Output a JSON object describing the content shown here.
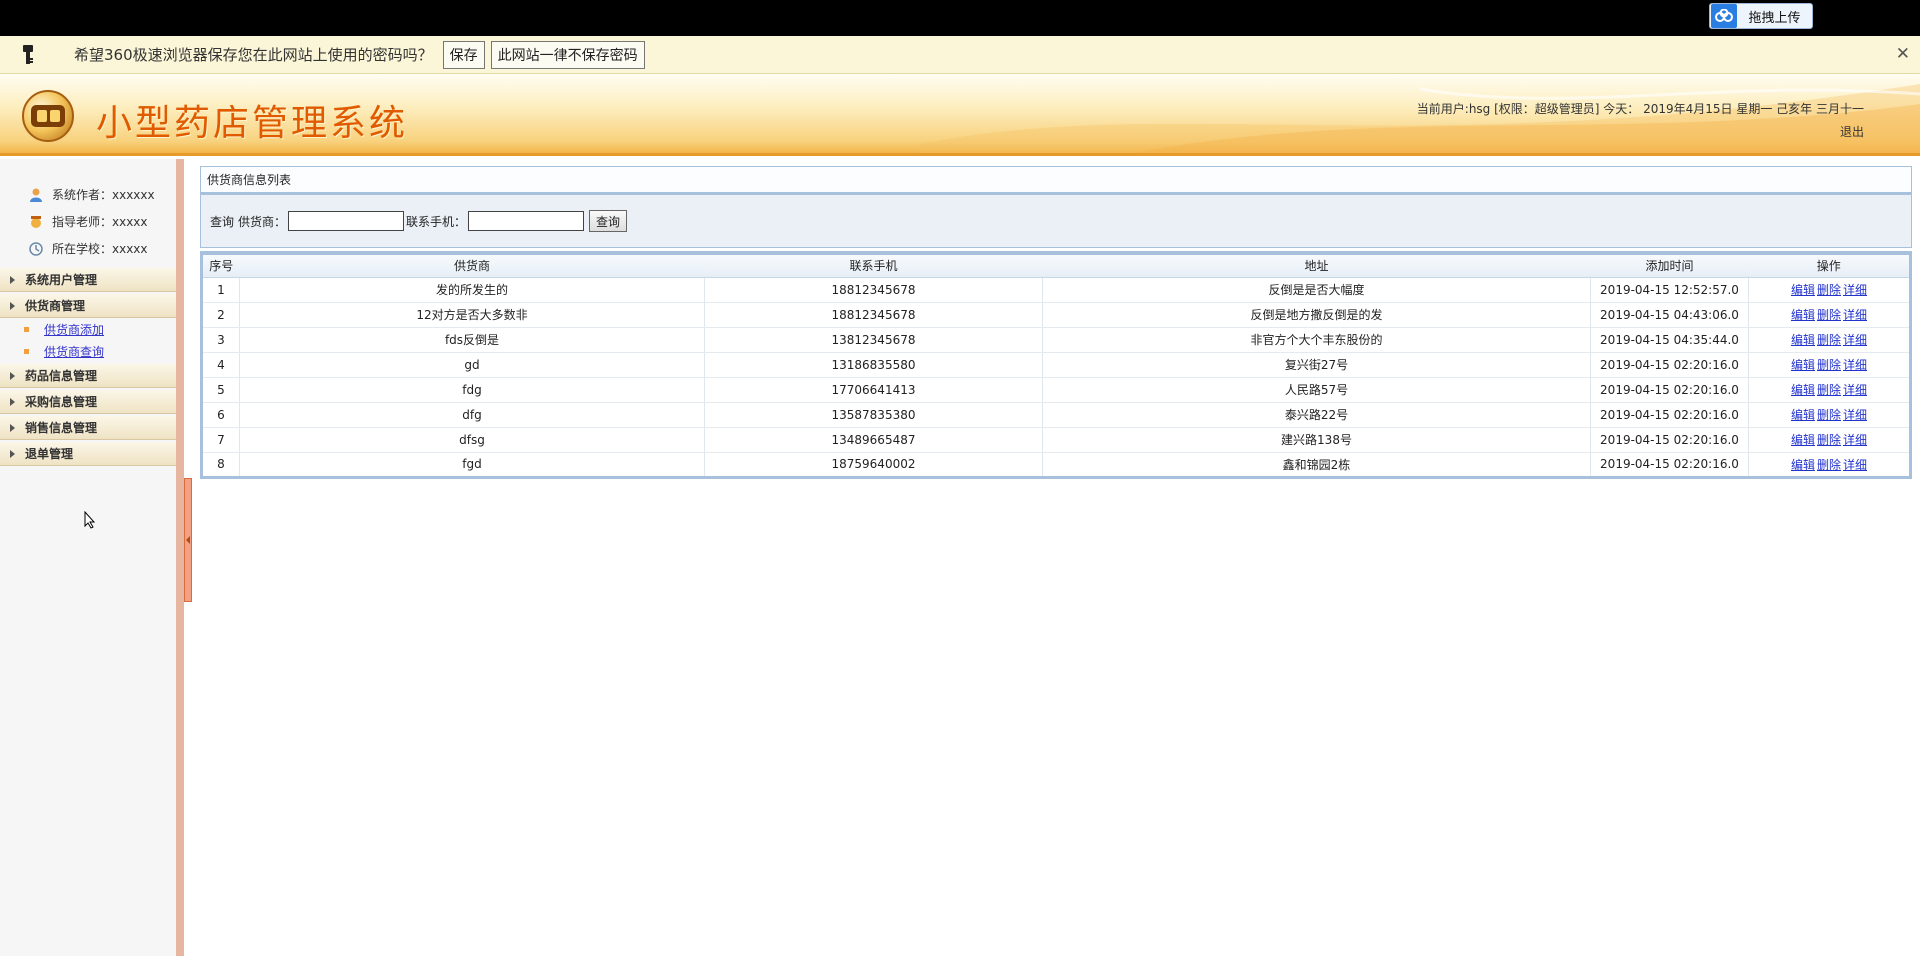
{
  "topbar": {
    "upload_label": "拖拽上传",
    "upload_icon": "cloud-icon"
  },
  "password_prompt": {
    "message": "希望360极速浏览器保存您在此网站上使用的密码吗？",
    "save_label": "保存",
    "never_label": "此网站一律不保存密码",
    "close_glyph": "✕"
  },
  "header": {
    "title": "小型药店管理系统",
    "user_info": "当前用户:hsg [权限：超级管理员] 今天： 2019年4月15日 星期一 己亥年 三月十一",
    "logout_label": "退出"
  },
  "sidebar": {
    "info": [
      {
        "label": "系统作者：xxxxxx",
        "icon": "user-icon"
      },
      {
        "label": "指导老师：xxxxx",
        "icon": "teacher-icon"
      },
      {
        "label": "所在学校：xxxxx",
        "icon": "school-icon"
      }
    ],
    "menu": [
      {
        "label": "系统用户管理"
      },
      {
        "label": "供货商管理",
        "items": [
          "供货商添加",
          "供货商查询"
        ]
      },
      {
        "label": "药品信息管理"
      },
      {
        "label": "采购信息管理"
      },
      {
        "label": "销售信息管理"
      },
      {
        "label": "退单管理"
      }
    ]
  },
  "main": {
    "panel_title": "供货商信息列表",
    "search": {
      "prefix": "查询",
      "supplier_label": "供货商：",
      "supplier_value": "",
      "phone_label": "联系手机：",
      "phone_value": "",
      "submit_label": "查询"
    },
    "table": {
      "columns": [
        "序号",
        "供货商",
        "联系手机",
        "地址",
        "添加时间",
        "操作"
      ],
      "rows": [
        {
          "id": "1",
          "supplier": "发的所发生的",
          "phone": "18812345678",
          "address": "反倒是是否大幅度",
          "time": "2019-04-15 12:52:57.0"
        },
        {
          "id": "2",
          "supplier": "12对方是否大多数非",
          "phone": "18812345678",
          "address": "反倒是地方撒反倒是的发",
          "time": "2019-04-15 04:43:06.0"
        },
        {
          "id": "3",
          "supplier": "fds反倒是",
          "phone": "13812345678",
          "address": "非官方个大个丰东股份的",
          "time": "2019-04-15 04:35:44.0"
        },
        {
          "id": "4",
          "supplier": "gd",
          "phone": "13186835580",
          "address": "复兴街27号",
          "time": "2019-04-15 02:20:16.0"
        },
        {
          "id": "5",
          "supplier": "fdg",
          "phone": "17706641413",
          "address": "人民路57号",
          "time": "2019-04-15 02:20:16.0"
        },
        {
          "id": "6",
          "supplier": "dfg",
          "phone": "13587835380",
          "address": "泰兴路22号",
          "time": "2019-04-15 02:20:16.0"
        },
        {
          "id": "7",
          "supplier": "dfsg",
          "phone": "13489665487",
          "address": "建兴路138号",
          "time": "2019-04-15 02:20:16.0"
        },
        {
          "id": "8",
          "supplier": "fgd",
          "phone": "18759640002",
          "address": "鑫和锦园2栋",
          "time": "2019-04-15 02:20:16.0"
        }
      ],
      "actions": {
        "edit": "编辑",
        "delete": "删除",
        "detail": "详细"
      }
    }
  },
  "colors": {
    "accent": "#e05a00",
    "header_border": "#e59a2a",
    "table_border": "#a7c1dd",
    "link": "#2233cc"
  }
}
